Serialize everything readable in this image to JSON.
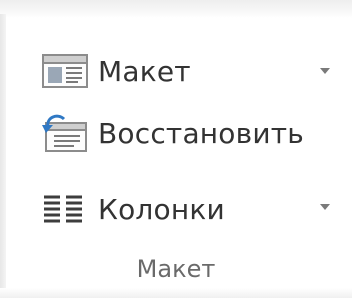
{
  "group": {
    "label": "Макет",
    "items": [
      {
        "label": "Макет",
        "icon": "page-layout-icon",
        "has_dropdown": true
      },
      {
        "label": "Восстановить",
        "icon": "restore-layout-icon",
        "has_dropdown": false
      },
      {
        "label": "Колонки",
        "icon": "columns-icon",
        "has_dropdown": true
      }
    ]
  }
}
